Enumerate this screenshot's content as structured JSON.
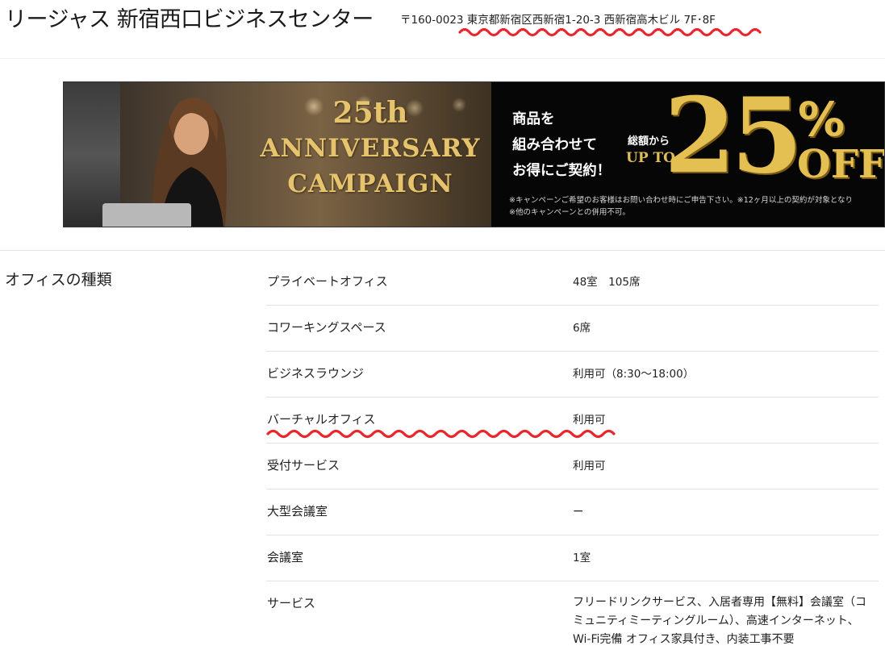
{
  "header": {
    "title": "リージャス 新宿西口ビジネスセンター",
    "address": "〒160-0023 東京都新宿区西新宿1-20-3 西新宿高木ビル 7F･8F"
  },
  "banner": {
    "anniversary_number": "25th",
    "anniversary_line1": "ANNIVERSARY",
    "anniversary_line2": "CAMPAIGN",
    "promo_line1": "商品を",
    "promo_line2": "組み合わせて",
    "promo_line3": "お得にご契約！",
    "promo_from": "総額から",
    "promo_upto": "UP TO",
    "promo_number": "25",
    "promo_percent": "%",
    "promo_off": "OFF",
    "note_line1": "※キャンペーンご希望のお客様はお問い合わせ時にご申告下さい。※12ヶ月以上の契約が対象となり",
    "note_line2": "※他のキャンペーンとの併用不可。"
  },
  "office_types": {
    "section_title": "オフィスの種類",
    "rows": [
      {
        "label": "プライベートオフィス",
        "value": "48室　105席"
      },
      {
        "label": "コワーキングスペース",
        "value": "6席"
      },
      {
        "label": "ビジネスラウンジ",
        "value": "利用可（8:30～18:00）"
      },
      {
        "label": "バーチャルオフィス",
        "value": "利用可"
      },
      {
        "label": "受付サービス",
        "value": "利用可"
      },
      {
        "label": "大型会議室",
        "value": "ー"
      },
      {
        "label": "会議室",
        "value": "1室"
      },
      {
        "label": "サービス",
        "value": "フリードリンクサービス、入居者専用【無料】会議室（コミュニティミーティングルーム）、高速インターネット、Wi-Fi完備 オフィス家具付き、内装工事不要"
      }
    ]
  },
  "colors": {
    "highlight_wave": "#e8262b",
    "banner_gold": "#e4bf52"
  }
}
